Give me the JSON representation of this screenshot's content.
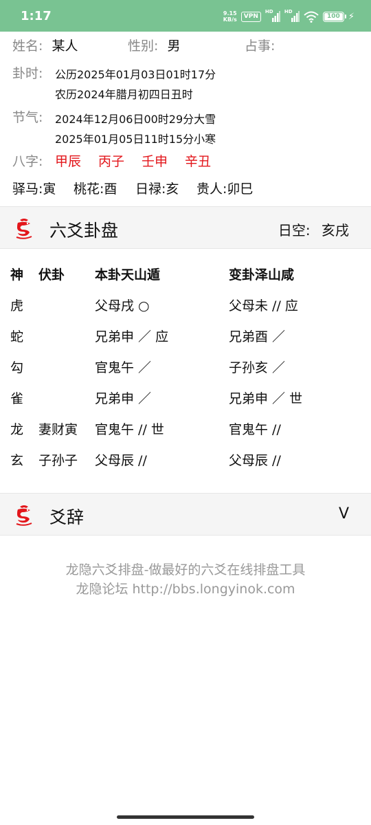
{
  "status": {
    "time": "1:17",
    "speed_top": "9.15",
    "speed_unit": "KB/s",
    "vpn": "VPN",
    "hd1": "HD",
    "hd2": "HD",
    "battery": "100"
  },
  "info": {
    "name_label": "姓名:",
    "name_value": "某人",
    "gender_label": "性别:",
    "gender_value": "男",
    "divination_label": "占事:",
    "divination_value": "",
    "time_label": "卦时:",
    "gregorian": "公历2025年01月03日01时17分",
    "lunar": "农历2024年腊月初四日丑时",
    "solar_label": "节气:",
    "solar_term_1": "2024年12月06日00时29分大雪",
    "solar_term_2": "2025年01月05日11时15分小寒",
    "bazi_label": "八字:",
    "bazi": [
      "甲辰",
      "丙子",
      "壬申",
      "辛丑"
    ],
    "shensha": [
      "驿马:寅",
      "桃花:酉",
      "日禄:亥",
      "贵人:卯巳"
    ]
  },
  "section_gua": {
    "title": "六爻卦盘",
    "kong_label": "日空:",
    "kong_value": "亥戌"
  },
  "table": {
    "headers": [
      "神",
      "伏卦",
      "本卦天山遁",
      "变卦泽山咸"
    ],
    "rows": [
      [
        "虎",
        "",
        "父母戌 ○",
        "父母未 // 应"
      ],
      [
        "蛇",
        "",
        "兄弟申 ／ 应",
        "兄弟酉 ／"
      ],
      [
        "勾",
        "",
        "官鬼午 ／",
        "子孙亥 ／"
      ],
      [
        "雀",
        "",
        "兄弟申 ／",
        "兄弟申 ／ 世"
      ],
      [
        "龙",
        "妻财寅",
        "官鬼午 // 世",
        "官鬼午 //"
      ],
      [
        "玄",
        "子孙子",
        "父母辰 //",
        "父母辰 //"
      ]
    ]
  },
  "section_yaoci": {
    "title": "爻辞",
    "toggle": "V"
  },
  "footer": {
    "line1": "龙隐六爻排盘-做最好的六爻在线排盘工具",
    "line2": "龙隐论坛 http://bbs.longyinok.com"
  },
  "colors": {
    "status_bar": "#79c392",
    "accent_red": "#e3161b",
    "label_gray": "#888888"
  }
}
